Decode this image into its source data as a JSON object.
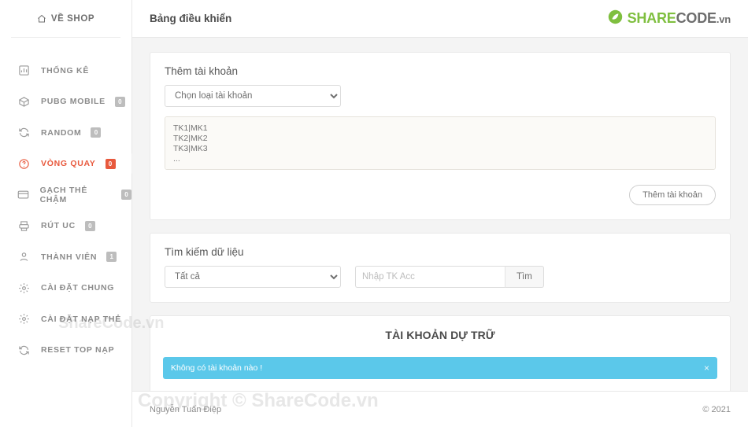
{
  "sidebar": {
    "shop_label": "VỀ SHOP",
    "home_icon": "home-icon",
    "items": [
      {
        "label": "THỐNG KÊ",
        "icon": "chart-bar-icon",
        "badge": null,
        "active": false
      },
      {
        "label": "PUBG MOBILE",
        "icon": "box-icon",
        "badge": "0",
        "active": false
      },
      {
        "label": "RANDOM",
        "icon": "refresh-icon",
        "badge": "0",
        "active": false
      },
      {
        "label": "VÒNG QUAY",
        "icon": "question-circle-icon",
        "badge": "0",
        "active": true
      },
      {
        "label": "GẠCH THẺ CHẬM",
        "icon": "credit-card-icon",
        "badge": "0",
        "active": false
      },
      {
        "label": "RÚT UC",
        "icon": "printer-icon",
        "badge": "0",
        "active": false
      },
      {
        "label": "THÀNH VIÊN",
        "icon": "user-icon",
        "badge": "1",
        "active": false
      },
      {
        "label": "CÀI ĐẶT CHUNG",
        "icon": "gear-icon",
        "badge": null,
        "active": false
      },
      {
        "label": "CÀI ĐẶT NẠP THẺ",
        "icon": "gear-icon",
        "badge": null,
        "active": false
      },
      {
        "label": "RESET TOP NẠP",
        "icon": "refresh-icon",
        "badge": null,
        "active": false
      }
    ]
  },
  "topbar": {
    "title": "Bảng điều khiển",
    "brand": {
      "logo_icon": "sharecode-leaf-icon",
      "share": "SHARE",
      "code": "CODE",
      "vn": ".vn"
    }
  },
  "add_account_card": {
    "title": "Thêm tài khoản",
    "type_select": {
      "selected": "Chọn loại tài khoản",
      "options": [
        "Chọn loại tài khoản"
      ]
    },
    "accounts_placeholder": "TK1|MK1\nTK2|MK2\nTK3|MK3\n...",
    "submit_label": "Thêm tài khoản"
  },
  "search_card": {
    "title": "Tìm kiếm dữ liệu",
    "filter_select": {
      "selected": "Tất cả",
      "options": [
        "Tất cả"
      ]
    },
    "input_placeholder": "Nhập TK Acc",
    "input_value": "",
    "search_label": "Tìm"
  },
  "reserve_card": {
    "title": "TÀI KHOẢN DỰ TRỮ",
    "alert_text": "Không có tài khoản nào !",
    "alert_close_icon": "close-icon",
    "alert_color": "#5bc8ea"
  },
  "watermarks": {
    "small": "ShareCode.vn",
    "big": "Copyright © ShareCode.vn"
  },
  "footer": {
    "left": "Nguyễn Tuấn Điệp",
    "right": "© 2021"
  }
}
